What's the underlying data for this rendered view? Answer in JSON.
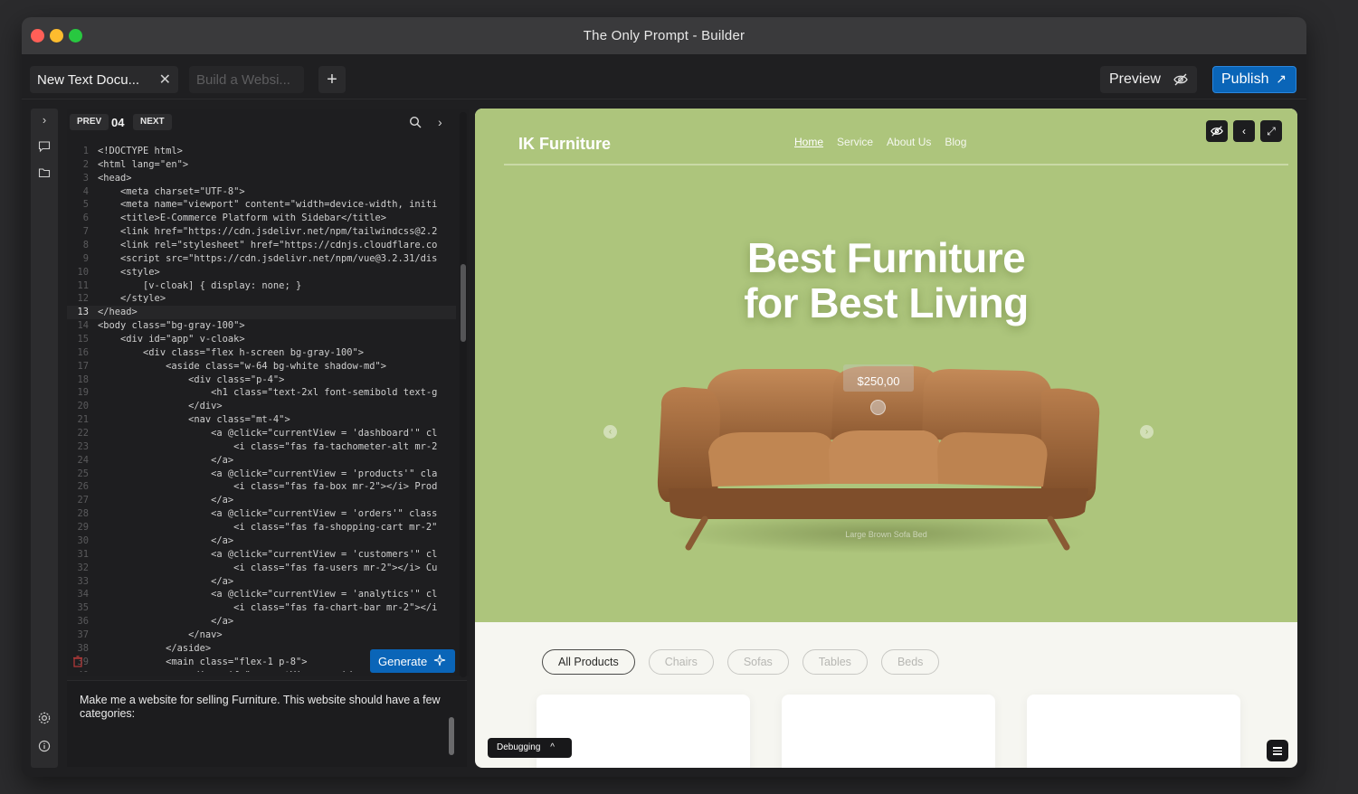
{
  "window": {
    "title": "The Only Prompt - Builder"
  },
  "tabs": [
    {
      "label": "New Text Docu...",
      "active": true
    },
    {
      "label": "Build a Websi...",
      "active": false
    }
  ],
  "toolbar": {
    "preview_label": "Preview",
    "publish_label": "Publish"
  },
  "editor": {
    "prev_label": "PREV",
    "next_label": "NEXT",
    "page_number": "04",
    "current_line": 13,
    "generate_label": "Generate",
    "lines": [
      "<!DOCTYPE html>",
      "<html lang=\"en\">",
      "<head>",
      "    <meta charset=\"UTF-8\">",
      "    <meta name=\"viewport\" content=\"width=device-width, initi",
      "    <title>E-Commerce Platform with Sidebar</title>",
      "    <link href=\"https://cdn.jsdelivr.net/npm/tailwindcss@2.2",
      "    <link rel=\"stylesheet\" href=\"https://cdnjs.cloudflare.co",
      "    <script src=\"https://cdn.jsdelivr.net/npm/vue@3.2.31/dis",
      "    <style>",
      "        [v-cloak] { display: none; }",
      "    </style>",
      "</head>",
      "<body class=\"bg-gray-100\">",
      "    <div id=\"app\" v-cloak>",
      "        <div class=\"flex h-screen bg-gray-100\">",
      "            <aside class=\"w-64 bg-white shadow-md\">",
      "                <div class=\"p-4\">",
      "                    <h1 class=\"text-2xl font-semibold text-g",
      "                </div>",
      "                <nav class=\"mt-4\">",
      "                    <a @click=\"currentView = 'dashboard'\" cl",
      "                        <i class=\"fas fa-tachometer-alt mr-2",
      "                    </a>",
      "                    <a @click=\"currentView = 'products'\" cla",
      "                        <i class=\"fas fa-box mr-2\"></i> Prod",
      "                    </a>",
      "                    <a @click=\"currentView = 'orders'\" class",
      "                        <i class=\"fas fa-shopping-cart mr-2\"",
      "                    </a>",
      "                    <a @click=\"currentView = 'customers'\" cl",
      "                        <i class=\"fas fa-users mr-2\"></i> Cu",
      "                    </a>",
      "                    <a @click=\"currentView = 'analytics'\" cl",
      "                        <i class=\"fas fa-chart-bar mr-2\"></i",
      "                    </a>",
      "                </nav>",
      "            </aside>",
      "            <main class=\"flex-1 p-8\">",
      "                <div v-if=\"currentView === 'da"
    ]
  },
  "prompt": {
    "text": "Make me a website for selling Furniture. This website should have a few categories:"
  },
  "site": {
    "brand": "IK Furniture",
    "nav": [
      {
        "label": "Home",
        "active": true
      },
      {
        "label": "Service",
        "active": false
      },
      {
        "label": "About Us",
        "active": false
      },
      {
        "label": "Blog",
        "active": false
      }
    ],
    "headline_line1": "Best Furniture",
    "headline_line2": "for Best Living",
    "price": "$250,00",
    "price_caption": "",
    "product_caption": "Large Brown Sofa Bed",
    "filters": [
      {
        "label": "All Products",
        "active": true
      },
      {
        "label": "Chairs",
        "active": false
      },
      {
        "label": "Sofas",
        "active": false
      },
      {
        "label": "Tables",
        "active": false
      },
      {
        "label": "Beds",
        "active": false
      }
    ],
    "hero_color": "#adc57c"
  },
  "debug_label": "Debugging",
  "colors": {
    "accent": "#0a65b8",
    "hero": "#adc57c",
    "sofa": "#b07a4c"
  }
}
